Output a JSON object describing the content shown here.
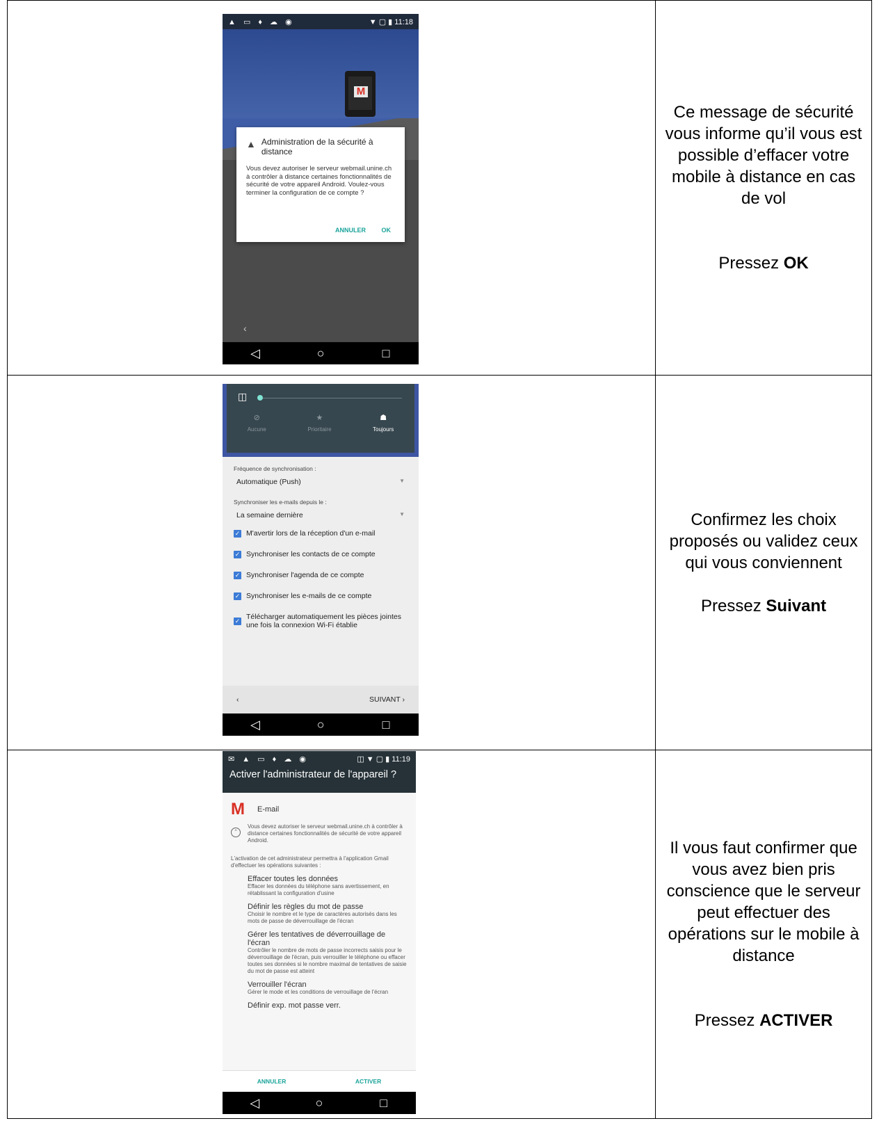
{
  "rows": [
    {
      "description": "Ce message de sécurité vous informe qu’il vous est possible d’effacer votre mobile à distance en cas de vol",
      "press_prefix": "Pressez",
      "press_action": "OK"
    },
    {
      "description": "Confirmez les choix proposés ou validez ceux qui vous conviennent",
      "press_prefix": "Pressez",
      "press_action": "Suivant"
    },
    {
      "description": "Il vous faut confirmer que vous avez bien pris conscience que le serveur peut effectuer des opérations sur le mobile à distance",
      "press_prefix": "Pressez",
      "press_action": "ACTIVER"
    }
  ],
  "phone1": {
    "status_time": "11:18",
    "dialog_title": "Administration de la sécurité à distance",
    "dialog_body": "Vous devez autoriser le serveur webmail.unine.ch à contrôler à distance certaines fonctionnalités de sécurité de votre appareil Android. Voulez-vous terminer la configuration de ce compte ?",
    "cancel_label": "ANNULER",
    "ok_label": "OK"
  },
  "phone2": {
    "modes": [
      "Aucune",
      "Prioritaire",
      "Toujours"
    ],
    "sync_freq_label": "Fréquence de synchronisation :",
    "sync_freq_value": "Automatique (Push)",
    "sync_since_label": "Synchroniser les e-mails depuis le :",
    "sync_since_value": "La semaine dernière",
    "checkboxes": [
      "M'avertir lors de la réception d'un e-mail",
      "Synchroniser les contacts de ce compte",
      "Synchroniser l'agenda de ce compte",
      "Synchroniser les e-mails de ce compte",
      "Télécharger automatiquement les pièces jointes une fois la connexion Wi-Fi établie"
    ],
    "next_label": "SUIVANT"
  },
  "phone3": {
    "status_time": "11:19",
    "title": "Activer l'administrateur de l'appareil ?",
    "app_name": "E-mail",
    "info": "Vous devez autoriser le serveur webmail.unine.ch à contrôler à distance certaines fonctionnalités de sécurité de votre appareil Android.",
    "intro": "L'activation de cet administrateur permettra à l'application Gmail d'effectuer les opérations suivantes :",
    "permissions": [
      {
        "title": "Effacer toutes les données",
        "desc": "Effacer les données du téléphone sans avertissement, en rétablissant la configuration d'usine"
      },
      {
        "title": "Définir les règles du mot de passe",
        "desc": "Choisir le nombre et le type de caractères autorisés dans les mots de passe de déverrouillage de l'écran"
      },
      {
        "title": "Gérer les tentatives de déverrouillage de l'écran",
        "desc": "Contrôler le nombre de mots de passe incorrects saisis pour le déverrouillage de l'écran, puis verrouiller le téléphone ou effacer toutes ses données si le nombre maximal de tentatives de saisie du mot de passe est atteint"
      },
      {
        "title": "Verrouiller l'écran",
        "desc": "Gérer le mode et les conditions de verrouillage de l'écran"
      },
      {
        "title": "Définir exp. mot passe verr.",
        "desc": ""
      }
    ],
    "cancel_label": "ANNULER",
    "activate_label": "ACTIVER"
  }
}
